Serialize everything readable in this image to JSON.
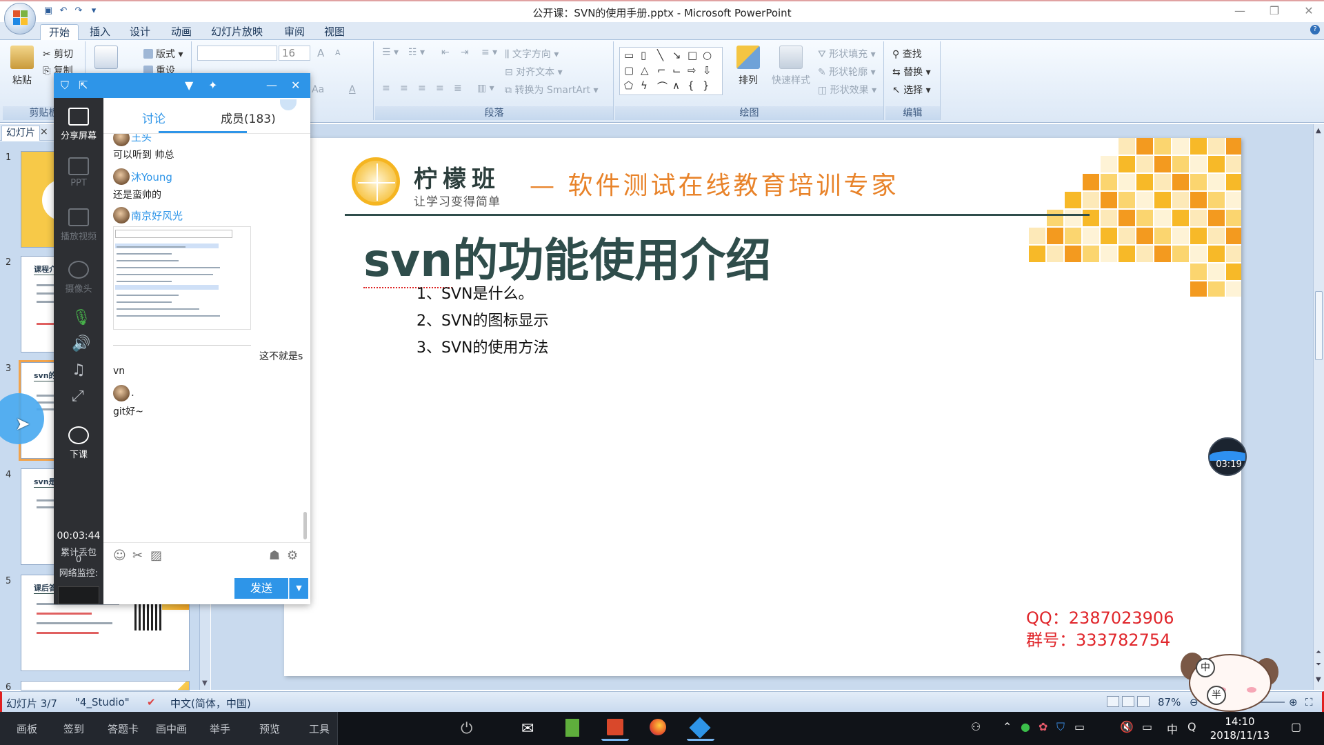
{
  "window": {
    "title": "公开课：SVN的使用手册.pptx - Microsoft PowerPoint",
    "controls": [
      "—",
      "❐",
      "✕"
    ]
  },
  "ribbon": {
    "tabs": [
      "开始",
      "插入",
      "设计",
      "动画",
      "幻灯片放映",
      "审阅",
      "视图"
    ],
    "active_tab": "开始",
    "clipboard": {
      "label": "剪贴板",
      "paste": "粘贴",
      "cut": "剪切",
      "copy": "复制"
    },
    "slides": {
      "layout": "版式",
      "reset": "重设"
    },
    "font": {
      "size": "16",
      "grow": "A",
      "shrink": "A",
      "case": "Aa"
    },
    "paragraph": {
      "label": "段落",
      "text_direction": "文字方向",
      "align_text": "对齐文本",
      "smartart": "转换为 SmartArt"
    },
    "drawing": {
      "label": "绘图",
      "arrange": "排列",
      "quick_styles": "快速样式",
      "shape_fill": "形状填充",
      "shape_outline": "形状轮廓",
      "shape_effects": "形状效果"
    },
    "editing": {
      "label": "编辑",
      "find": "查找",
      "replace": "替换",
      "select": "选择"
    }
  },
  "slide_panel": {
    "tab": "幻灯片",
    "close": "×",
    "thumbs": [
      {
        "num": "1"
      },
      {
        "num": "2",
        "title": "课程介"
      },
      {
        "num": "3",
        "title": "svn的"
      },
      {
        "num": "4",
        "title": "svn是"
      },
      {
        "num": "5",
        "title": "课后答"
      },
      {
        "num": "6"
      }
    ]
  },
  "slide": {
    "logo_name": "柠檬班",
    "logo_sub": "让学习变得简单",
    "slogan": "— 软件测试在线教育培训专家",
    "title_prefix": "svn",
    "title_rest": "的功能使用介绍",
    "items": [
      "1、SVN是什么。",
      "2、SVN的图标显示",
      "3、SVN的使用方法"
    ],
    "contact_qq": "QQ：2387023906",
    "contact_group": "群号：333782754"
  },
  "timer_bubble": "03:19",
  "statusbar": {
    "slide": "幻灯片 3/7",
    "theme": "\"4_Studio\"",
    "language": "中文(简体，中国)",
    "zoom": "87%",
    "zoom_level_percent": 87
  },
  "chat": {
    "side": {
      "share": "分享屏幕",
      "ppt": "PPT",
      "video": "播放视频",
      "camera": "摄像头",
      "end_class": "下课",
      "elapsed": "00:03:44",
      "packet_loss_label": "累计丢包",
      "packet_loss": "0",
      "network": "网络监控:"
    },
    "tabs": {
      "discussion": "讨论",
      "members": "成员(183)"
    },
    "messages": [
      {
        "name": "王头",
        "text": "可以听到 帅总"
      },
      {
        "name": "沐Young",
        "text": "还是蛮帅的"
      },
      {
        "name": "南京好风光",
        "text": "这不就是s",
        "text2": "vn"
      },
      {
        "name": ".",
        "text": "git好~"
      }
    ],
    "send": "发送",
    "send_drop": "▼"
  },
  "taskbar": {
    "tools": [
      "画板",
      "签到",
      "答题卡",
      "画中画",
      "举手",
      "预览",
      "工具"
    ],
    "time": "14:10",
    "date": "2018/11/13",
    "ime": "中",
    "sound": "🔇"
  },
  "colors": {
    "accent": "#2e95e8",
    "slide_title": "#2f4d4b",
    "slogan": "#e8832a",
    "contact": "#e0262b",
    "lemon": "#f5b521"
  }
}
